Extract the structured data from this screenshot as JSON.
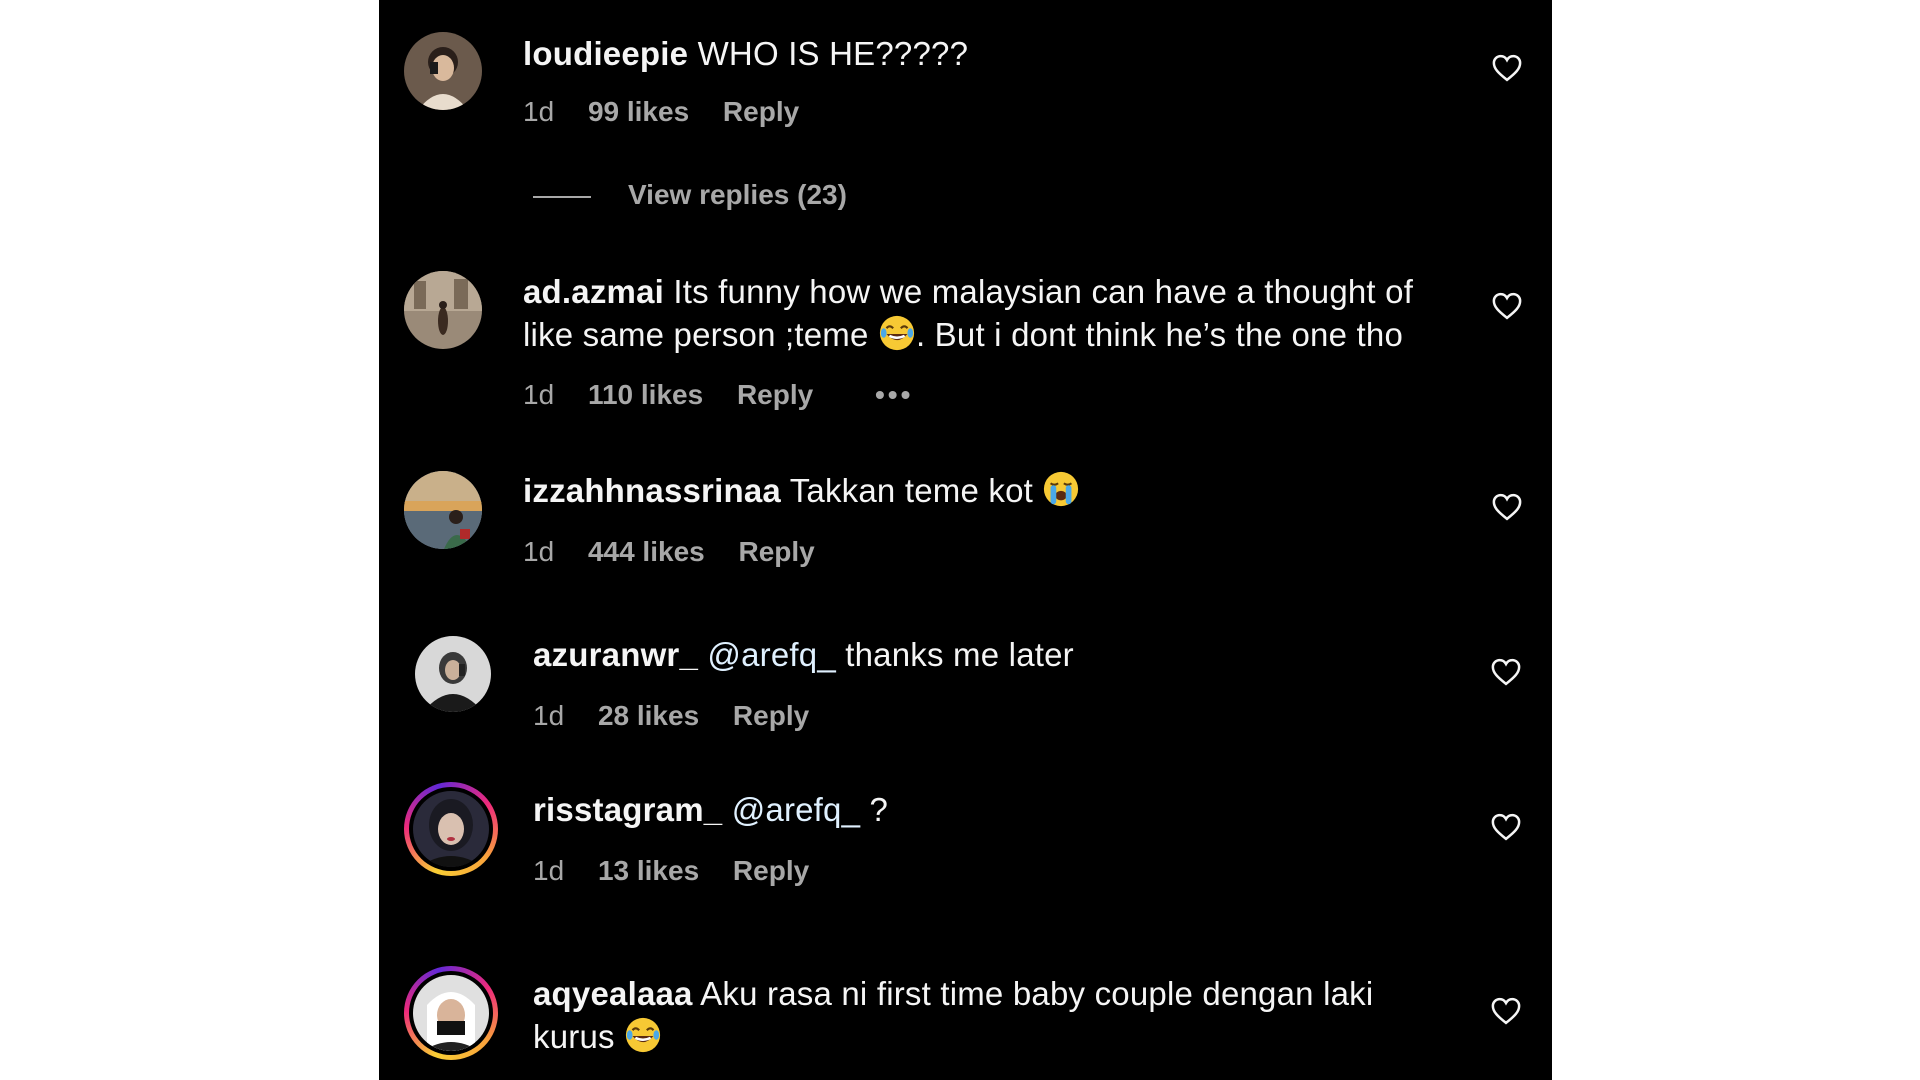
{
  "comments": [
    {
      "username": "loudieepie",
      "text": "WHO IS HE?????",
      "age": "1d",
      "likes": "99 likes",
      "reply": "Reply",
      "view_replies": "View replies (23)"
    },
    {
      "username": "ad.azmai",
      "text_part1": "Its funny how we malaysian can have a thought of like same person ;teme",
      "text_part2": ". But i dont think he’s the one tho",
      "age": "1d",
      "likes": "110 likes",
      "reply": "Reply",
      "more": "•••"
    },
    {
      "username": "izzahhnassrinaa",
      "text": "Takkan teme kot",
      "age": "1d",
      "likes": "444 likes",
      "reply": "Reply"
    },
    {
      "username": "azuranwr_",
      "mention": "@arefq_",
      "text": "thanks me later",
      "age": "1d",
      "likes": "28 likes",
      "reply": "Reply"
    },
    {
      "username": "risstagram_",
      "mention": "@arefq_",
      "text": "?",
      "age": "1d",
      "likes": "13 likes",
      "reply": "Reply"
    },
    {
      "username": "aqyealaaa",
      "text": "Aku rasa ni first time baby couple dengan laki kurus"
    }
  ],
  "icons": {
    "like": "heart-outline-icon",
    "laugh": "face-with-tears-of-joy-emoji",
    "cry": "loudly-crying-face-emoji"
  },
  "colors": {
    "background": "#000000",
    "primary_text": "#f5f5f5",
    "secondary_text": "#a8a8a8",
    "story_ring_start": "#f9ce34",
    "story_ring_mid": "#ee2a7b"
  }
}
